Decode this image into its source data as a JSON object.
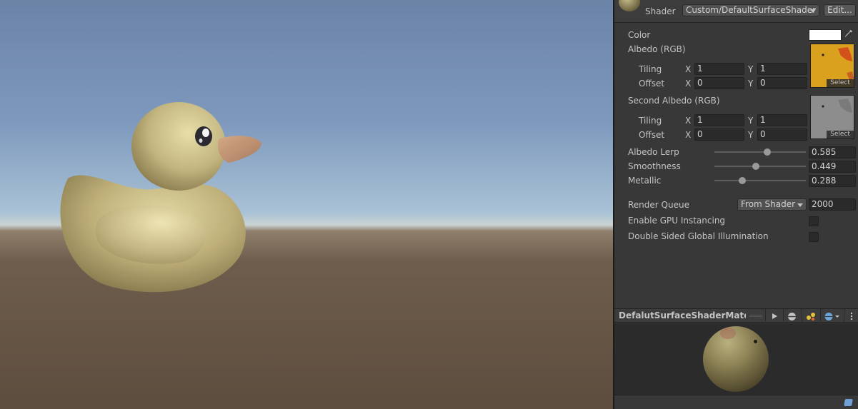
{
  "inspector": {
    "shader_label": "Shader",
    "shader_value": "Custom/DefaultSurfaceShader",
    "edit_label": "Edit...",
    "properties": {
      "color_label": "Color",
      "color_value": "#ffffff",
      "albedo_label": "Albedo (RGB)",
      "second_albedo_label": "Second Albedo (RGB)",
      "tiling_label": "Tiling",
      "offset_label": "Offset",
      "x_label": "X",
      "y_label": "Y",
      "select_label": "Select",
      "albedo": {
        "tiling_x": "1",
        "tiling_y": "1",
        "offset_x": "0",
        "offset_y": "0"
      },
      "second_albedo": {
        "tiling_x": "1",
        "tiling_y": "1",
        "offset_x": "0",
        "offset_y": "0"
      },
      "albedo_lerp_label": "Albedo Lerp",
      "albedo_lerp_value": "0.585",
      "smoothness_label": "Smoothness",
      "smoothness_value": "0.449",
      "metallic_label": "Metallic",
      "metallic_value": "0.288",
      "render_queue_label": "Render Queue",
      "render_queue_source": "From Shader",
      "render_queue_value": "2000",
      "gpu_instancing_label": "Enable GPU Instancing",
      "gpu_instancing_checked": false,
      "double_sided_gi_label": "Double Sided Global Illumination",
      "double_sided_gi_checked": false
    },
    "preview": {
      "title": "DefalutSurfaceShaderMateria"
    }
  },
  "colors": {
    "albedo_texture": "#d9a11e",
    "second_albedo_texture": "#8d8d8d",
    "duck_body": "#c9be88"
  },
  "icons": [
    "eyedropper-icon",
    "play-icon",
    "sphere-icon",
    "lights-icon",
    "sky-icon",
    "more-icon",
    "tag-icon"
  ]
}
